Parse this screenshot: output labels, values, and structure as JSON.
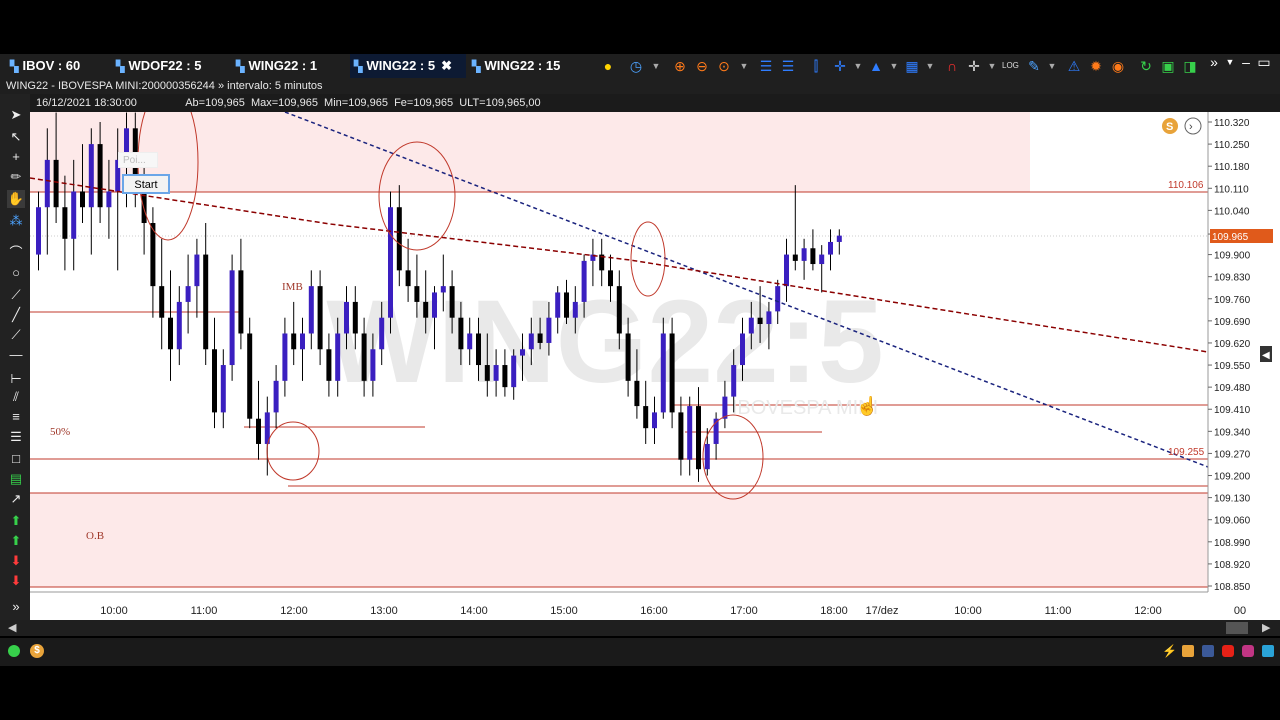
{
  "tabs": [
    {
      "label": "IBOV : 60"
    },
    {
      "label": "WDOF22 : 5"
    },
    {
      "label": "WING22 : 1"
    },
    {
      "label": "WING22 : 5",
      "active": true
    },
    {
      "label": "WING22 : 15"
    }
  ],
  "chart_header": {
    "title": "WING22 - IBOVESPA MINI:200000356244 » intervalo: 5 minutos",
    "quote_line": "16/12/2021 18:30:00                Ab=109,965  Max=109,965  Min=109,965  Fe=109,965  ULT=109,965,00"
  },
  "watermark": {
    "symbol": "WING22:5",
    "subtitle": "IBOVESPA MINI"
  },
  "chart_data": {
    "type": "candlestick",
    "price_axis": [
      "110.320",
      "110.250",
      "110.180",
      "110.110",
      "110.040",
      "109.965",
      "109.900",
      "109.830",
      "109.760",
      "109.690",
      "109.620",
      "109.550",
      "109.480",
      "109.410",
      "109.340",
      "109.270",
      "109.200",
      "109.130",
      "109.060",
      "108.990",
      "108.920",
      "108.850"
    ],
    "current_price_label": "109.965",
    "level_labels": {
      "upper": "110.106",
      "lower": "109.255"
    },
    "time_axis": [
      "10:00",
      "11:00",
      "12:00",
      "13:00",
      "14:00",
      "15:00",
      "16:00",
      "17:00",
      "18:00",
      "17/dez",
      "10:00",
      "11:00",
      "12:00",
      "00"
    ],
    "annotations": [
      "IMB",
      "50%",
      "O.B"
    ],
    "colors": {
      "bull": "#3a1fc0",
      "bear": "#000000",
      "zone": "#fde9e9",
      "trend_blue": "#1a237e",
      "trend_red": "#8b0000"
    },
    "candles": [
      [
        109.9,
        110.1,
        109.85,
        110.05
      ],
      [
        110.05,
        110.3,
        109.9,
        110.2
      ],
      [
        110.2,
        110.35,
        110.0,
        110.05
      ],
      [
        110.05,
        110.15,
        109.85,
        109.95
      ],
      [
        109.95,
        110.2,
        109.85,
        110.1
      ],
      [
        110.1,
        110.25,
        110.0,
        110.05
      ],
      [
        110.05,
        110.3,
        109.9,
        110.25
      ],
      [
        110.25,
        110.32,
        110.0,
        110.05
      ],
      [
        110.05,
        110.2,
        109.95,
        110.1
      ],
      [
        110.1,
        110.3,
        109.85,
        110.2
      ],
      [
        110.2,
        110.35,
        110.05,
        110.3
      ],
      [
        110.3,
        110.35,
        110.05,
        110.1
      ],
      [
        110.1,
        110.2,
        109.9,
        110.0
      ],
      [
        110.0,
        110.05,
        109.7,
        109.8
      ],
      [
        109.8,
        109.95,
        109.6,
        109.7
      ],
      [
        109.7,
        109.85,
        109.5,
        109.6
      ],
      [
        109.6,
        109.8,
        109.55,
        109.75
      ],
      [
        109.75,
        109.9,
        109.65,
        109.8
      ],
      [
        109.8,
        109.95,
        109.7,
        109.9
      ],
      [
        109.9,
        110.0,
        109.55,
        109.6
      ],
      [
        109.6,
        109.7,
        109.35,
        109.4
      ],
      [
        109.4,
        109.6,
        109.35,
        109.55
      ],
      [
        109.55,
        109.9,
        109.5,
        109.85
      ],
      [
        109.85,
        109.95,
        109.6,
        109.65
      ],
      [
        109.65,
        109.7,
        109.35,
        109.38
      ],
      [
        109.38,
        109.5,
        109.25,
        109.3
      ],
      [
        109.3,
        109.45,
        109.2,
        109.4
      ],
      [
        109.4,
        109.55,
        109.35,
        109.5
      ],
      [
        109.5,
        109.7,
        109.45,
        109.65
      ],
      [
        109.65,
        109.75,
        109.55,
        109.6
      ],
      [
        109.6,
        109.7,
        109.5,
        109.65
      ],
      [
        109.65,
        109.85,
        109.6,
        109.8
      ],
      [
        109.8,
        109.85,
        109.55,
        109.6
      ],
      [
        109.6,
        109.65,
        109.45,
        109.5
      ],
      [
        109.5,
        109.7,
        109.45,
        109.65
      ],
      [
        109.65,
        109.8,
        109.6,
        109.75
      ],
      [
        109.75,
        109.8,
        109.6,
        109.65
      ],
      [
        109.65,
        109.7,
        109.45,
        109.5
      ],
      [
        109.5,
        109.65,
        109.45,
        109.6
      ],
      [
        109.6,
        109.75,
        109.55,
        109.7
      ],
      [
        109.7,
        110.1,
        109.65,
        110.05
      ],
      [
        110.05,
        110.12,
        109.8,
        109.85
      ],
      [
        109.85,
        109.95,
        109.75,
        109.8
      ],
      [
        109.8,
        109.9,
        109.7,
        109.75
      ],
      [
        109.75,
        109.85,
        109.65,
        109.7
      ],
      [
        109.7,
        109.8,
        109.6,
        109.78
      ],
      [
        109.78,
        109.9,
        109.72,
        109.8
      ],
      [
        109.8,
        109.85,
        109.65,
        109.7
      ],
      [
        109.7,
        109.75,
        109.55,
        109.6
      ],
      [
        109.6,
        109.7,
        109.55,
        109.65
      ],
      [
        109.65,
        109.7,
        109.5,
        109.55
      ],
      [
        109.55,
        109.65,
        109.45,
        109.5
      ],
      [
        109.5,
        109.6,
        109.45,
        109.55
      ],
      [
        109.55,
        109.6,
        109.45,
        109.48
      ],
      [
        109.48,
        109.6,
        109.44,
        109.58
      ],
      [
        109.58,
        109.65,
        109.5,
        109.6
      ],
      [
        109.6,
        109.7,
        109.55,
        109.65
      ],
      [
        109.65,
        109.7,
        109.6,
        109.62
      ],
      [
        109.62,
        109.75,
        109.58,
        109.7
      ],
      [
        109.7,
        109.8,
        109.65,
        109.78
      ],
      [
        109.78,
        109.82,
        109.68,
        109.7
      ],
      [
        109.7,
        109.8,
        109.65,
        109.75
      ],
      [
        109.75,
        109.9,
        109.7,
        109.88
      ],
      [
        109.88,
        109.95,
        109.8,
        109.9
      ],
      [
        109.9,
        109.95,
        109.8,
        109.85
      ],
      [
        109.85,
        109.9,
        109.75,
        109.8
      ],
      [
        109.8,
        109.85,
        109.6,
        109.65
      ],
      [
        109.65,
        109.7,
        109.45,
        109.5
      ],
      [
        109.5,
        109.6,
        109.38,
        109.42
      ],
      [
        109.42,
        109.5,
        109.3,
        109.35
      ],
      [
        109.35,
        109.45,
        109.3,
        109.4
      ],
      [
        109.4,
        109.7,
        109.38,
        109.65
      ],
      [
        109.65,
        109.7,
        109.35,
        109.4
      ],
      [
        109.4,
        109.45,
        109.2,
        109.25
      ],
      [
        109.25,
        109.45,
        109.2,
        109.42
      ],
      [
        109.42,
        109.48,
        109.18,
        109.22
      ],
      [
        109.22,
        109.35,
        109.2,
        109.3
      ],
      [
        109.3,
        109.4,
        109.25,
        109.38
      ],
      [
        109.38,
        109.5,
        109.35,
        109.45
      ],
      [
        109.45,
        109.6,
        109.4,
        109.55
      ],
      [
        109.55,
        109.7,
        109.5,
        109.65
      ],
      [
        109.65,
        109.75,
        109.6,
        109.7
      ],
      [
        109.7,
        109.8,
        109.62,
        109.68
      ],
      [
        109.68,
        109.75,
        109.6,
        109.72
      ],
      [
        109.72,
        109.82,
        109.68,
        109.8
      ],
      [
        109.8,
        109.95,
        109.75,
        109.9
      ],
      [
        109.9,
        110.12,
        109.85,
        109.88
      ],
      [
        109.88,
        109.95,
        109.82,
        109.92
      ],
      [
        109.92,
        109.98,
        109.85,
        109.87
      ],
      [
        109.87,
        109.93,
        109.78,
        109.9
      ],
      [
        109.9,
        109.98,
        109.85,
        109.94
      ],
      [
        109.94,
        109.98,
        109.9,
        109.96
      ]
    ]
  }
}
